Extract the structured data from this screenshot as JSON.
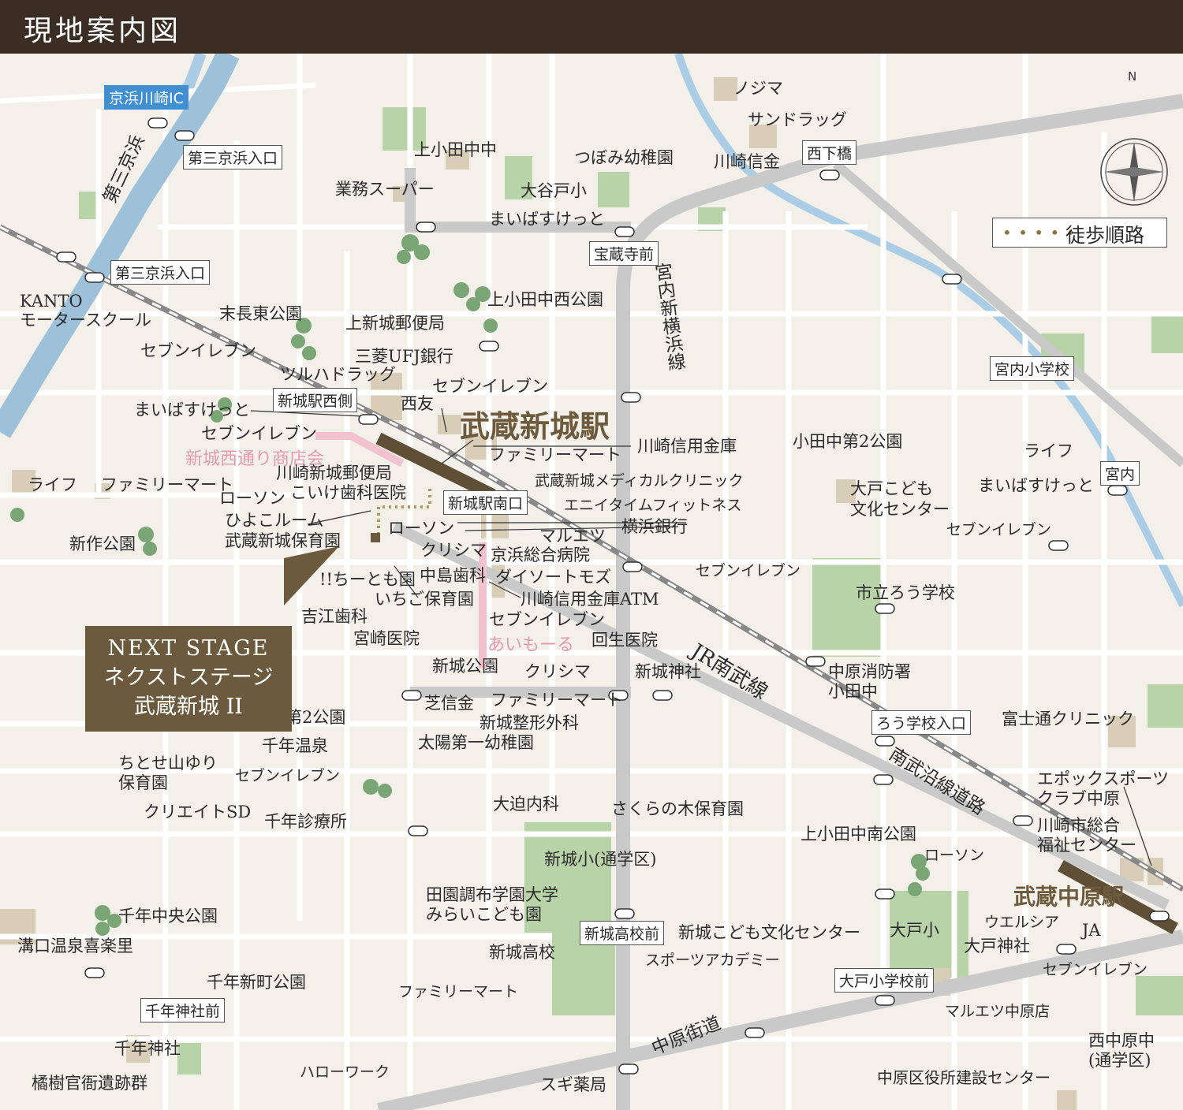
{
  "header": {
    "title": "現地案内図"
  },
  "property": {
    "line1": "NEXT STAGE",
    "line2": "ネクストステージ",
    "line3": "武蔵新城 II"
  },
  "legend": {
    "dots": "• • • • •",
    "label": "徒歩順路"
  },
  "compass": {
    "north": "N"
  },
  "stations": {
    "musashi_shinjo": "武蔵新城駅",
    "musashi_nakahara": "武蔵中原駅"
  },
  "roads": {
    "daisan_keihin": "第三京浜",
    "miyauchi_shin_yokohama": "宮内新横浜線",
    "jr_nambu": "JR南武線",
    "nambu_ensen": "南武沿線道路",
    "nakahara_kaido": "中原街道"
  },
  "interchange": {
    "keihin_kawasaki": "京浜川崎IC"
  },
  "intersections": [
    "第三京浜入口",
    "第三京浜入口",
    "西下橋",
    "宝蔵寺前",
    "新城駅西側",
    "新城駅南口",
    "宮内小学校",
    "宮内",
    "ろう学校入口",
    "新城高校前",
    "大戸小学校前",
    "千年神社前"
  ],
  "shopping_streets": {
    "shinjo_nishidori": "新城西通り商店会",
    "aimoru": "あいもーる"
  },
  "landmarks": [
    "ノジマ",
    "サンドラッグ",
    "川崎信金",
    "上小田中中",
    "つぼみ幼稚園",
    "業務スーパー",
    "大谷戸小",
    "まいばすけっと",
    "上小田中西公園",
    "KANTO",
    "モータースクール",
    "末長東公園",
    "上新城郵便局",
    "三菱UFJ銀行",
    "セブンイレブン",
    "ツルハドラッグ",
    "セブンイレブン",
    "西友",
    "まいばすけっと",
    "セブンイレブン",
    "川崎信用金庫",
    "ファミリーマート",
    "武蔵新城メディカルクリニック",
    "川崎新城郵便局",
    "こいけ歯科医院",
    "エニイタイムフィットネス",
    "横浜銀行",
    "ローソン",
    "ひよこルーム",
    "武蔵新城保育園",
    "ライフ",
    "ファミリーマート",
    "新作公園",
    "ローソン",
    "マルエツ",
    "クリシマ",
    "京浜総合病院",
    "中島歯科",
    "ダイソートモズ",
    "!!ちーとも園",
    "いちご保育園",
    "川崎信用金庫ATM",
    "吉江歯科",
    "セブンイレブン",
    "宮崎医院",
    "回生医院",
    "新城公園",
    "クリシマ",
    "新城神社",
    "芝信金",
    "ファミリーマート",
    "新城整形外科",
    "太陽第一幼稚園",
    "千年第2公園",
    "千年温泉",
    "ちとせ山ゆり",
    "保育園",
    "セブンイレブン",
    "クリエイトSD",
    "千年診療所",
    "大迫内科",
    "さくらの木保育園",
    "小田中第2公園",
    "大戸こども",
    "文化センター",
    "ライフ",
    "まいばすけっと",
    "セブンイレブン",
    "セブンイレブン",
    "市立ろう学校",
    "中原消防署",
    "小田中",
    "富士通クリニック",
    "エポックスポーツ",
    "クラブ中原",
    "川崎市総合",
    "福祉センター",
    "上小田中南公園",
    "ローソン",
    "新城小(通学区)",
    "田園調布学園大学",
    "みらいこども園",
    "新城高校",
    "新城こども文化センター",
    "スポーツアカデミー",
    "大戸小",
    "ウエルシア",
    "JA",
    "大戸神社",
    "セブンイレブン",
    "マルエツ中原店",
    "千年中央公園",
    "溝口温泉喜楽里",
    "千年新町公園",
    "ファミリーマート",
    "千年神社",
    "橘樹官衙遺跡群",
    "ハローワーク",
    "スギ薬局",
    "中原区役所建設センター",
    "西中原中",
    "(通学区)"
  ]
}
